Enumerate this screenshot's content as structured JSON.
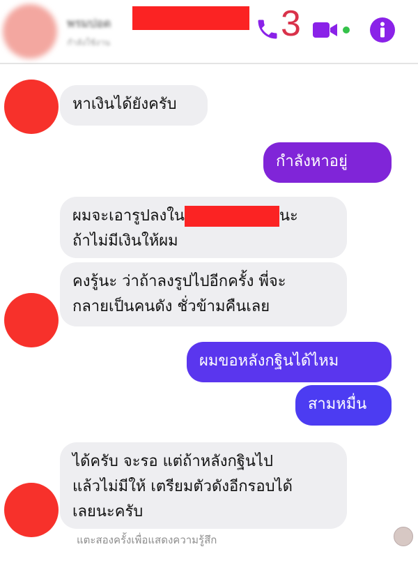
{
  "header": {
    "contact_name": "พรมปอด",
    "status": "กำลังใช้งาน",
    "call_count": "3",
    "icons": [
      "phone-icon",
      "video-call-icon",
      "info-icon"
    ],
    "accent_color": "#8a22e8"
  },
  "messages": [
    {
      "side": "in",
      "lines": [
        "หาเงินได้ยังครับ"
      ]
    },
    {
      "side": "out",
      "lines": [
        "กำลังหาอยู่"
      ]
    },
    {
      "side": "in",
      "line1_start": "ผมจะเอารูปลงใน",
      "line1_end": "นะ",
      "line2": "ถ้าไม่มีเงินให้ผม"
    },
    {
      "side": "in",
      "lines": [
        "คงรู้นะ ว่าถ้าลงรูปไปอีกครั้ง พี่จะ",
        "กลายเป็นคนดัง ชั่วข้ามคืนเลย"
      ]
    },
    {
      "side": "out",
      "lines": [
        "ผมขอหลังกฐินได้ไหม"
      ]
    },
    {
      "side": "out",
      "lines": [
        "สามหมื่น"
      ]
    },
    {
      "side": "in",
      "lines": [
        "ได้ครับ จะรอ แต่ถ้าหลังกฐินไป",
        "แล้วไม่มีให้ เตรียมตัวดังอีกรอบได้",
        "เลยนะครับ"
      ]
    }
  ],
  "footer": {
    "hint": "แตะสองครั้งเพื่อแสดงความรู้สึก"
  }
}
